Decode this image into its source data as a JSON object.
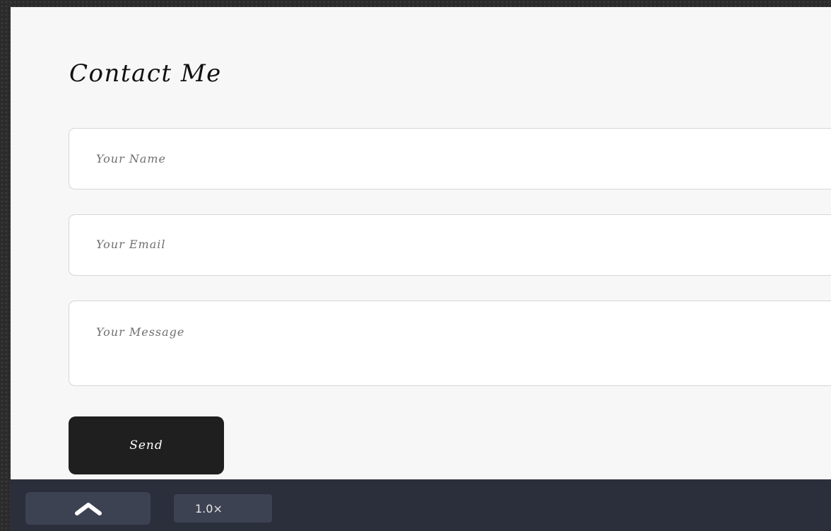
{
  "contact_form": {
    "title": "Contact Me",
    "name_placeholder": "Your Name",
    "email_placeholder": "Your Email",
    "message_placeholder": "Your Message",
    "send_label": "Send"
  },
  "toolbar": {
    "scroll_up_icon": "chevron-up-icon",
    "zoom_label": "1.0×"
  },
  "colors": {
    "page_background": "#f7f7f7",
    "send_button": "#1f1f1f",
    "toolbar_background": "#2b2f3b"
  }
}
